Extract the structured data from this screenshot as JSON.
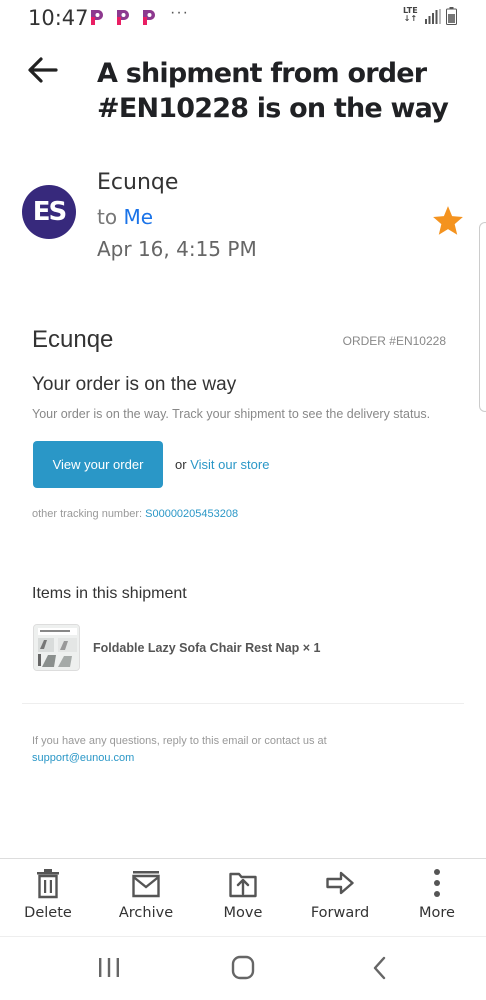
{
  "status_bar": {
    "time": "10:47",
    "overflow": "···",
    "network_top": "LTE",
    "network_bottom": "↓↑",
    "icons": [
      "app-notification-icon",
      "app-notification-icon",
      "app-notification-icon",
      "signal-icon",
      "battery-icon"
    ]
  },
  "email": {
    "subject": "A shipment from order #EN10228 is on the way",
    "avatar_initials": "ES",
    "sender": "Ecunqe",
    "to_prefix": "to",
    "to_name": "Me",
    "date": "Apr 16, 4:15 PM",
    "starred": true
  },
  "body": {
    "shop_name": "Ecunqe",
    "order_number": "ORDER #EN10228",
    "heading": "Your order is on the way",
    "description": "Your order is on the way. Track your shipment to see the delivery status.",
    "view_button": "View your order",
    "or_text": "or",
    "visit_link": "Visit our store",
    "tracking_label": "other tracking number:",
    "tracking_number": "S00000205453208",
    "items_title": "Items in this shipment",
    "items": [
      {
        "name": "Foldable Lazy Sofa Chair Rest Nap × 1"
      }
    ],
    "footer_text": "If you have any questions, reply to this email or contact us at",
    "support_email": "support@eunou.com"
  },
  "actions": [
    {
      "label": "Delete",
      "icon": "trash-icon"
    },
    {
      "label": "Archive",
      "icon": "archive-icon"
    },
    {
      "label": "Move",
      "icon": "move-icon"
    },
    {
      "label": "Forward",
      "icon": "forward-icon"
    },
    {
      "label": "More",
      "icon": "more-vertical-icon"
    }
  ],
  "colors": {
    "accent": "#1a73e8",
    "button": "#2a97c7",
    "star": "#f4931f",
    "avatar": "#37297c",
    "notification": "#e91e63"
  }
}
